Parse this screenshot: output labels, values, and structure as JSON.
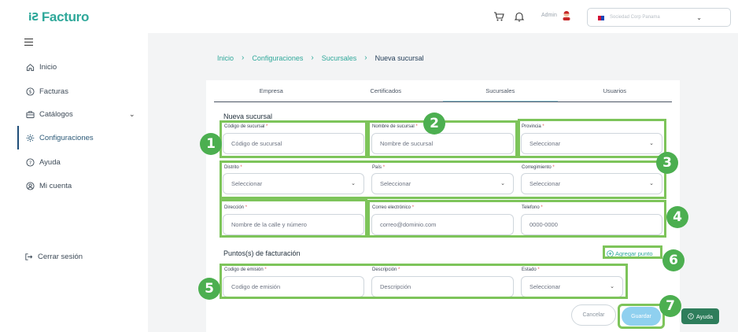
{
  "app": {
    "logo_mark": "iƧ",
    "logo_text": "Facturo"
  },
  "topbar": {
    "admin_label": "Admin",
    "company_placeholder": "Sociedad Corp Panama"
  },
  "sidebar": {
    "items": [
      {
        "label": "Inicio",
        "icon": "home-icon"
      },
      {
        "label": "Facturas",
        "icon": "dollar-circle-icon"
      },
      {
        "label": "Catálogos",
        "icon": "briefcase-icon"
      },
      {
        "label": "Configuraciones",
        "icon": "gear-icon"
      },
      {
        "label": "Ayuda",
        "icon": "help-circle-icon"
      },
      {
        "label": "Mi cuenta",
        "icon": "user-circle-icon"
      }
    ],
    "logout": "Cerrar sesión"
  },
  "breadcrumb": [
    "Inicio",
    "Configuraciones",
    "Sucursales",
    "Nueva sucursal"
  ],
  "tabs": [
    "Empresa",
    "Certificados",
    "Sucursales",
    "Usuarios"
  ],
  "form": {
    "title": "Nueva sucursal",
    "codigo_label": "Código de sucursal",
    "codigo_placeholder": "Código de sucursal",
    "nombre_label": "Nombre de sucursal",
    "nombre_placeholder": "Nombre de sucursal",
    "provincia_label": "Provincia",
    "provincia_value": "Seleccionar",
    "distrito_label": "Distrito",
    "distrito_value": "Seleccionar",
    "pais_label": "País",
    "pais_value": "Seleccionar",
    "corregimiento_label": "Corregimiento",
    "corregimiento_value": "Seleccionar",
    "direccion_label": "Dirección",
    "direccion_placeholder": "Nombre de la calle y número",
    "correo_label": "Correo electrónico",
    "correo_placeholder": "correo@dominio.com",
    "telefono_label": "Telefono",
    "telefono_placeholder": "0000-0000",
    "puntos_title": "Puntos(s) de facturación",
    "add_point": "Agregar punto",
    "emision_label": "Codigo de emisión",
    "emision_placeholder": "Codigo de emisión",
    "descripcion_label": "Descripción",
    "descripcion_placeholder": "Descripción",
    "estado_label": "Estado",
    "estado_value": "Seleccionar",
    "required_mark": "*"
  },
  "buttons": {
    "cancel": "Cancelar",
    "save": "Guardar",
    "help": "Ayuda"
  },
  "annotations": [
    "1",
    "2",
    "3",
    "4",
    "5",
    "6",
    "7"
  ],
  "colors": {
    "brand": "#2fa89a",
    "annotation_green": "#7dc45a",
    "badge_green": "#4caf50",
    "save_button": "#8fd0ef",
    "help_button": "#2e7d5b"
  }
}
